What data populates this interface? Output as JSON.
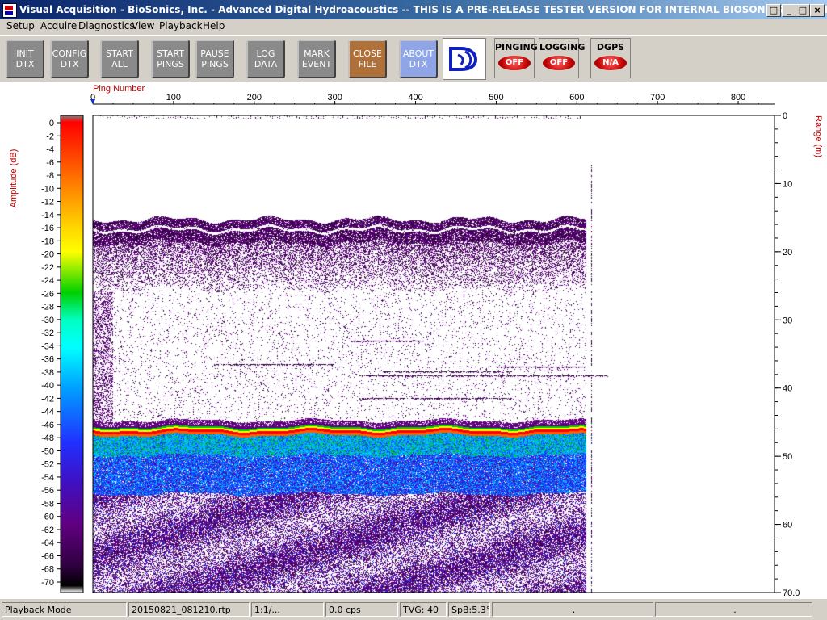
{
  "window": {
    "title": "Visual Acquisition  -  BioSonics, Inc.  -  Advanced Digital Hydroacoustics  -- THIS IS A PRE-RELEASE TESTER VERSION FOR INTERNAL BIOSONICS USE ONLY",
    "icon": "app-icon"
  },
  "menu": [
    "Setup",
    "Acquire",
    "Diagnostics",
    "View",
    "Playback",
    "Help"
  ],
  "toolbar": {
    "buttons": [
      {
        "line1": "INIT",
        "line2": "DTX"
      },
      {
        "line1": "CONFIG",
        "line2": "DTX"
      },
      {
        "line1": "START",
        "line2": "ALL"
      },
      {
        "line1": "START",
        "line2": "PINGS"
      },
      {
        "line1": "PAUSE",
        "line2": "PINGS"
      },
      {
        "line1": "LOG",
        "line2": "DATA"
      },
      {
        "line1": "MARK",
        "line2": "EVENT"
      },
      {
        "line1": "CLOSE",
        "line2": "FILE"
      },
      {
        "line1": "ABOUT",
        "line2": "DTX"
      }
    ],
    "indicators": [
      {
        "label": "PINGING",
        "state": "OFF"
      },
      {
        "label": "LOGGING",
        "state": "OFF"
      },
      {
        "label": "DGPS",
        "state": "N/A"
      }
    ],
    "logo": "biosonics-logo-icon"
  },
  "echogram": {
    "x_axis_label": "Ping Number",
    "x_ticks": [
      "0",
      "100",
      "200",
      "300",
      "400",
      "500",
      "600",
      "700",
      "800"
    ],
    "y_axis_label": "Range (m)",
    "y_ticks": [
      "0",
      "10",
      "20",
      "30",
      "40",
      "50",
      "60",
      "70.0"
    ],
    "colorbar_label": "Amplitude (dB)",
    "colorbar_ticks": [
      "0",
      "-2",
      "-4",
      "-6",
      "-8",
      "-10",
      "-12",
      "-14",
      "-16",
      "-18",
      "-20",
      "-22",
      "-24",
      "-26",
      "-28",
      "-30",
      "-32",
      "-34",
      "-36",
      "-38",
      "-40",
      "-42",
      "-44",
      "-46",
      "-48",
      "-50",
      "-52",
      "-54",
      "-56",
      "-58",
      "-60",
      "-62",
      "-64",
      "-66",
      "-68",
      "-70"
    ]
  },
  "chart_data": {
    "type": "heatmap",
    "title": "",
    "xlabel": "Ping Number",
    "ylabel": "Range (m)",
    "xlim": [
      0,
      845
    ],
    "ylim": [
      0,
      70
    ],
    "colorbar": {
      "label": "Amplitude (dB)",
      "range": [
        -70,
        0
      ]
    },
    "data_extent_pings": [
      0,
      612
    ],
    "surface_layer_range_m": [
      15.5,
      18.5
    ],
    "bottom_echo_range_m": [
      45.5,
      48.5
    ]
  },
  "status": {
    "mode": "Playback Mode",
    "file": "20150821_081210.rtp",
    "ratio": "1:1/...",
    "rate": "0.0 cps",
    "tvg": "TVG: 40",
    "spb": "SpB:5.3°",
    "field7": ".",
    "field8": "."
  }
}
